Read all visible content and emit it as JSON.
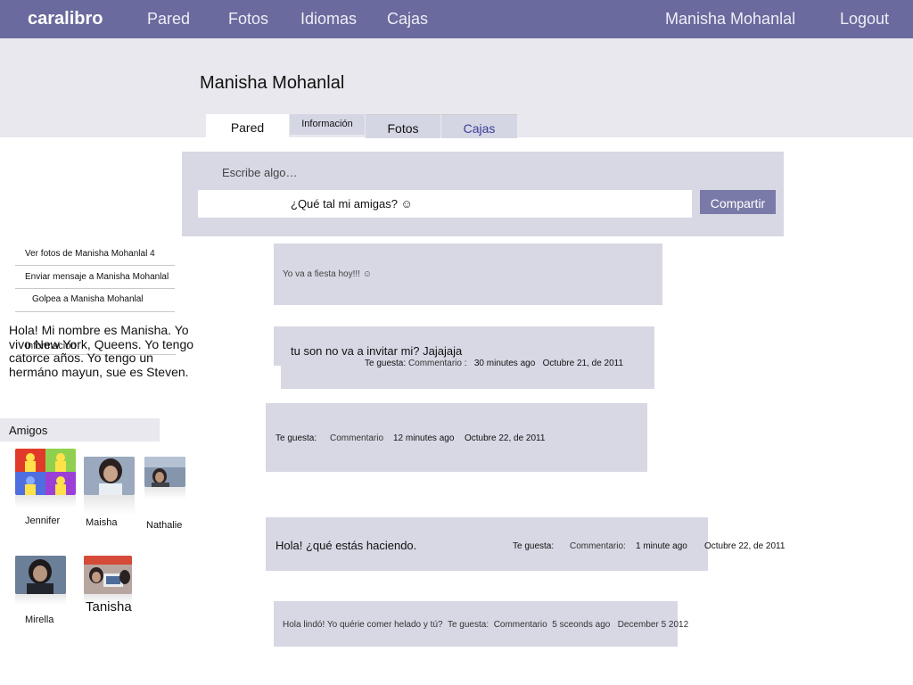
{
  "nav": {
    "brand": "caralibro",
    "items": [
      "Pared",
      "Fotos",
      "Idiomas",
      "Cajas"
    ],
    "user": "Manisha Mohanlal",
    "logout": "Logout",
    "bg_color": "#6a6a9e"
  },
  "profile": {
    "name": "Manisha Mohanlal",
    "tabs": [
      "Pared",
      "Información",
      "Fotos",
      "Cajas"
    ]
  },
  "composer": {
    "label": "Escribe algo…",
    "value": "¿Qué tal mi amigas? ☺",
    "share": "Compartir"
  },
  "sidebar": {
    "links": [
      "Ver fotos de Manisha Mohanlal 4",
      "Enviar mensaje a Manisha Mohanlal",
      "Golpea a Manisha Mohanlal"
    ],
    "info_label": "Información",
    "bio": "Hola! Mi nombre es Manisha. Yo vivo New York, Queens. Yo tengo catorce años. Yo  tengo un hermáno mayun, sue es Steven.",
    "friends_header": "Amigos",
    "friends": [
      "Jennifer",
      "Maisha",
      "Nathalie",
      "Mirella",
      "Tanisha"
    ]
  },
  "posts": [
    {
      "text": "Yo va a fiesta hoy!!! ☺"
    },
    {
      "text": "tu son no va a invitar mi? Jajajaja",
      "like": "Te guesta:",
      "comment": "Commentario",
      "sep": ":",
      "ago": "30 minutes ago",
      "date": "Octubre 21, de 2011"
    },
    {
      "like": "Te guesta:",
      "comment": "Commentario",
      "ago": "12  minutes ago",
      "date": "Octubre 22, de 2011"
    },
    {
      "text": "Hola! ¿qué estás haciendo.",
      "like": "Te guesta:",
      "comment": "Commentario:",
      "ago": "1 minute ago",
      "date": "Octubre 22, de 2011"
    },
    {
      "text": "Hola lindó! Yo quérie comer helado y tú?",
      "like": "Te guesta:",
      "comment": "Commentario",
      "ago": "5 sceonds ago",
      "date": "December 5 2012"
    }
  ]
}
